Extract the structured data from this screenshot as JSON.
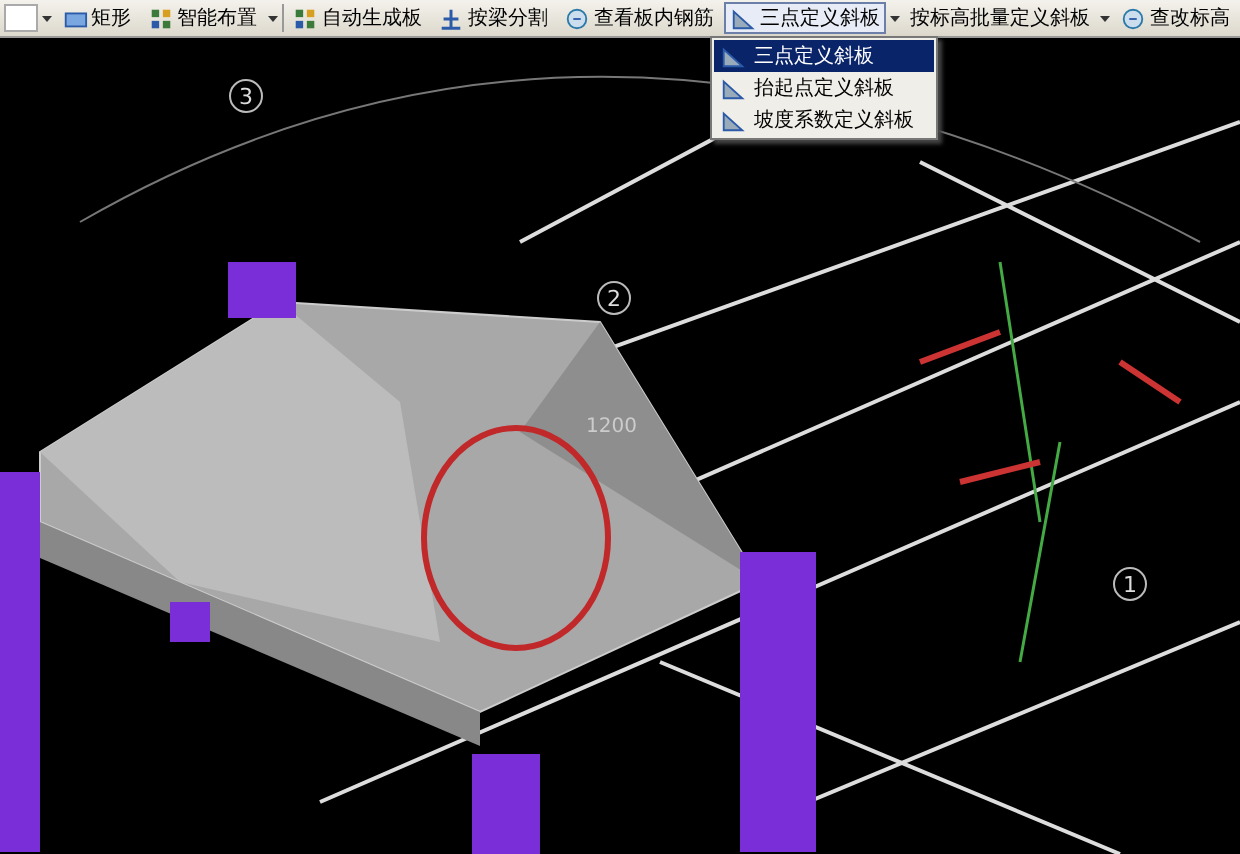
{
  "toolbar": {
    "items": [
      {
        "kind": "combo"
      },
      {
        "kind": "button",
        "label": "矩形"
      },
      {
        "kind": "dropdown",
        "label": "智能布置",
        "pressed": false
      },
      {
        "kind": "separator"
      },
      {
        "kind": "button",
        "label": "自动生成板"
      },
      {
        "kind": "button",
        "label": "按梁分割"
      },
      {
        "kind": "button",
        "label": "查看板内钢筋"
      },
      {
        "kind": "dropdown",
        "label": "三点定义斜板",
        "pressed": true
      },
      {
        "kind": "dropdown",
        "label": "按标高批量定义斜板",
        "pressed": false
      },
      {
        "kind": "button",
        "label": "查改标高"
      }
    ]
  },
  "menu": {
    "items": [
      {
        "label": "三点定义斜板",
        "selected": true
      },
      {
        "label": "抬起点定义斜板",
        "selected": false
      },
      {
        "label": "坡度系数定义斜板",
        "selected": false
      }
    ]
  },
  "viewport": {
    "labels": [
      {
        "kind": "axis",
        "text": "3"
      },
      {
        "kind": "axis",
        "text": "2"
      },
      {
        "kind": "dimension",
        "text": "1200"
      },
      {
        "kind": "axis",
        "text": "1"
      }
    ]
  }
}
